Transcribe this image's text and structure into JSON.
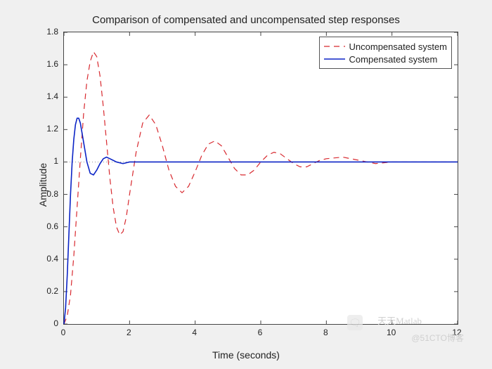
{
  "chart_data": {
    "type": "line",
    "title": "Comparison of compensated and uncompensated step responses",
    "xlabel": "Time (seconds)",
    "ylabel": "Amplitude",
    "xlim": [
      0,
      12
    ],
    "ylim": [
      0,
      1.8
    ],
    "xticks": [
      0,
      2,
      4,
      6,
      8,
      10,
      12
    ],
    "yticks": [
      0,
      0.2,
      0.4,
      0.6,
      0.8,
      1,
      1.2,
      1.4,
      1.6,
      1.8
    ],
    "reference_line": 1.0,
    "series": [
      {
        "name": "Uncompensated system",
        "color": "#d8292f",
        "dash": "8,6",
        "width": 1.2,
        "x": [
          0,
          0.1,
          0.2,
          0.3,
          0.4,
          0.5,
          0.6,
          0.7,
          0.8,
          0.9,
          1.0,
          1.1,
          1.2,
          1.3,
          1.4,
          1.5,
          1.6,
          1.7,
          1.8,
          1.9,
          2.0,
          2.2,
          2.4,
          2.6,
          2.8,
          3.0,
          3.2,
          3.4,
          3.6,
          3.8,
          4.0,
          4.2,
          4.4,
          4.6,
          4.8,
          5.0,
          5.2,
          5.4,
          5.6,
          5.8,
          6.0,
          6.2,
          6.4,
          6.6,
          6.8,
          7.0,
          7.2,
          7.4,
          7.6,
          7.8,
          8.0,
          8.5,
          9.0,
          9.5,
          10.0,
          10.5,
          11.0,
          11.5,
          12.0
        ],
        "y": [
          0,
          0.05,
          0.18,
          0.42,
          0.72,
          1.02,
          1.3,
          1.5,
          1.62,
          1.68,
          1.65,
          1.53,
          1.34,
          1.12,
          0.9,
          0.72,
          0.6,
          0.55,
          0.57,
          0.66,
          0.8,
          1.06,
          1.24,
          1.29,
          1.23,
          1.1,
          0.95,
          0.85,
          0.81,
          0.85,
          0.94,
          1.04,
          1.11,
          1.13,
          1.1,
          1.03,
          0.96,
          0.92,
          0.92,
          0.95,
          1.0,
          1.04,
          1.06,
          1.05,
          1.02,
          0.99,
          0.97,
          0.97,
          0.99,
          1.01,
          1.02,
          1.03,
          1.01,
          0.99,
          1.0,
          1.0,
          1.0,
          1.0,
          1.0
        ]
      },
      {
        "name": "Compensated system",
        "color": "#0b24c6",
        "dash": "",
        "width": 1.6,
        "x": [
          0,
          0.05,
          0.1,
          0.15,
          0.2,
          0.25,
          0.3,
          0.35,
          0.4,
          0.45,
          0.5,
          0.55,
          0.6,
          0.7,
          0.8,
          0.9,
          1.0,
          1.1,
          1.2,
          1.3,
          1.4,
          1.5,
          1.6,
          1.8,
          2.0,
          2.5,
          3.0,
          4.0,
          5.0,
          6.0,
          8.0,
          10.0,
          12.0
        ],
        "y": [
          0,
          0.1,
          0.3,
          0.55,
          0.8,
          1.0,
          1.14,
          1.23,
          1.27,
          1.27,
          1.24,
          1.18,
          1.12,
          1.0,
          0.93,
          0.92,
          0.95,
          0.99,
          1.02,
          1.03,
          1.02,
          1.01,
          1.0,
          0.99,
          1.0,
          1.0,
          1.0,
          1.0,
          1.0,
          1.0,
          1.0,
          1.0,
          1.0
        ]
      }
    ],
    "legend_position": "top-right"
  },
  "watermarks": {
    "brand": "天天Matlab",
    "site": "@51CTO博客"
  }
}
